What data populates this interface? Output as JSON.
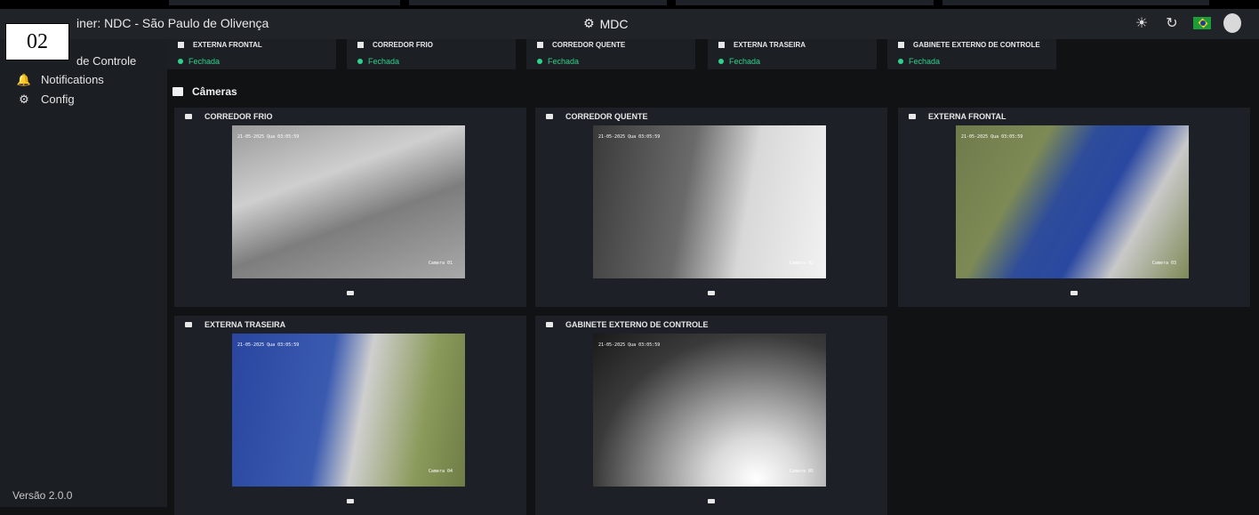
{
  "annotation_badge": "02",
  "header": {
    "container_title": "iner: NDC - São Paulo de Olivença",
    "app_title": "MDC"
  },
  "sidebar": {
    "items": [
      {
        "label": "de Controle",
        "icon": "dashboard-icon"
      },
      {
        "label": "Notifications",
        "icon": "alarm-icon"
      },
      {
        "label": "Config",
        "icon": "gear-icon"
      }
    ],
    "version": "Versão 2.0.0"
  },
  "doors": [
    {
      "name": "EXTERNA FRONTAL",
      "status": "Fechada"
    },
    {
      "name": "CORREDOR FRIO",
      "status": "Fechada"
    },
    {
      "name": "CORREDOR QUENTE",
      "status": "Fechada"
    },
    {
      "name": "EXTERNA TRASEIRA",
      "status": "Fechada"
    },
    {
      "name": "GABINETE EXTERNO DE CONTROLE",
      "status": "Fechada"
    }
  ],
  "cameras_section": {
    "title": "Câmeras"
  },
  "cameras": [
    {
      "name": "CORREDOR FRIO",
      "timestamp": "21-05-2025 Qua 03:05:59",
      "cam_label": "Camera 01"
    },
    {
      "name": "CORREDOR QUENTE",
      "timestamp": "21-05-2025 Qua 03:05:59",
      "cam_label": "Camera 02"
    },
    {
      "name": "EXTERNA FRONTAL",
      "timestamp": "21-05-2025 Qua 03:05:59",
      "cam_label": "Camera 03"
    },
    {
      "name": "EXTERNA TRASEIRA",
      "timestamp": "21-05-2025 Qua 03:05:59",
      "cam_label": "Camera 04"
    },
    {
      "name": "GABINETE EXTERNO DE CONTROLE",
      "timestamp": "21-05-2025 Qua 03:05:59",
      "cam_label": "Camera 05"
    }
  ],
  "colors": {
    "accent_status": "#2fd18b",
    "background": "#111214",
    "card": "#1d2127"
  }
}
